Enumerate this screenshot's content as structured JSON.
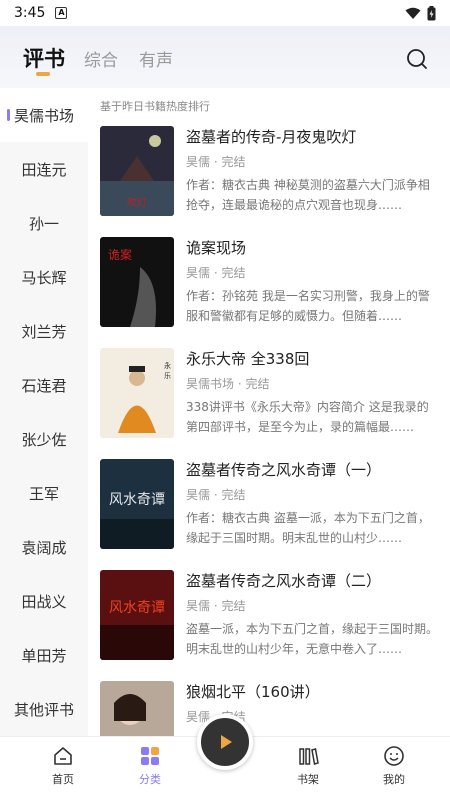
{
  "status": {
    "time": "3:45",
    "sim_icon": "A"
  },
  "header": {
    "tabs": [
      {
        "label": "评书",
        "active": true
      },
      {
        "label": "综合",
        "active": false
      },
      {
        "label": "有声",
        "active": false
      }
    ],
    "search_icon": "search-icon"
  },
  "sidebar": {
    "items": [
      {
        "label": "昊儒书场",
        "active": true
      },
      {
        "label": "田连元"
      },
      {
        "label": "孙一"
      },
      {
        "label": "马长辉"
      },
      {
        "label": "刘兰芳"
      },
      {
        "label": "石连君"
      },
      {
        "label": "张少佐"
      },
      {
        "label": "王军"
      },
      {
        "label": "袁阔成"
      },
      {
        "label": "田战义"
      },
      {
        "label": "单田芳"
      },
      {
        "label": "其他评书"
      }
    ]
  },
  "content": {
    "hint": "基于昨日书籍热度排行",
    "books": [
      {
        "title": "盗墓者的传奇-月夜鬼吹灯",
        "meta": "昊儒 · 完结",
        "desc": "作者：糖衣古典 神秘莫测的盗墓六大门派争相抢夺，连最最诡秘的点穴观音也现身……",
        "cover_color": "#2a2a3a"
      },
      {
        "title": "诡案现场",
        "meta": "昊儒 · 完结",
        "desc": "作者：孙铭苑 我是一名实习刑警，我身上的警服和警徽都有足够的威慑力。但随着……",
        "cover_color": "#1a1a1a"
      },
      {
        "title": "永乐大帝 全338回",
        "meta": "昊儒书场 · 完结",
        "desc": "338讲评书《永乐大帝》内容简介 这是我录的第四部评书，是至今为止，录的篇幅最……",
        "cover_color": "#f2ede0"
      },
      {
        "title": "盗墓者传奇之风水奇谭（一）",
        "meta": "昊儒 · 完结",
        "desc": "作者：糖衣古典 盗墓一派，本为下五门之首，缘起于三国时期。明末乱世的山村少……",
        "cover_color": "#1c3040"
      },
      {
        "title": "盗墓者传奇之风水奇谭（二）",
        "meta": "昊儒 · 完结",
        "desc": "盗墓一派，本为下五门之首，缘起于三国时期。明末乱世的山村少年，无意中卷入了……",
        "cover_color": "#5a1010"
      },
      {
        "title": "狼烟北平（160讲）",
        "meta": "昊儒 · 完结",
        "desc": "",
        "cover_color": "#b8a89a"
      }
    ]
  },
  "nav": {
    "items": [
      {
        "label": "首页",
        "icon": "home-icon"
      },
      {
        "label": "分类",
        "icon": "category-icon",
        "active": true
      },
      {
        "label": "书架",
        "icon": "bookshelf-icon"
      },
      {
        "label": "我的",
        "icon": "profile-icon"
      }
    ],
    "player_icon": "play-icon"
  },
  "colors": {
    "accent": "#8b7cf6",
    "tab_indicator": "#f0a640"
  }
}
